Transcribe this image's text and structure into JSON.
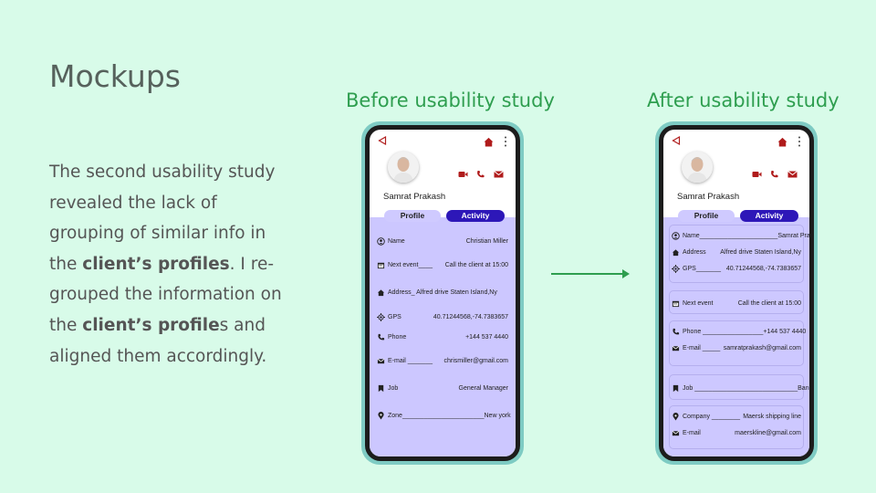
{
  "slide": {
    "title": "Mockups",
    "body": {
      "p1": "The second usability study revealed the lack of grouping of similar info in the ",
      "b1": "client’s profiles",
      "p2": ". I re-grouped the information on the ",
      "b2": "client’s profile",
      "p3": "s and aligned them accordingly."
    }
  },
  "before": {
    "heading": "Before usability study",
    "client_name": "Samrat Prakash",
    "tabs": {
      "profile": "Profile",
      "activity": "Activity"
    },
    "rows": [
      {
        "icon": "person-icon",
        "label": "Name",
        "value": "Christian Miller"
      },
      {
        "icon": "calendar-icon",
        "label": "Next event____",
        "value": "Call the client at 15:00"
      },
      {
        "icon": "home-icon",
        "label": "Address_ Alfred drive Staten Island,Ny",
        "value": ""
      },
      {
        "icon": "gps-icon",
        "label": "GPS",
        "value": "40.71244568,-74.7383657"
      },
      {
        "icon": "phone-icon",
        "label": "Phone",
        "value": "+144 537 4440"
      },
      {
        "icon": "mail-icon",
        "label": "E-mail _______",
        "value": "chrismiller@gmail.com"
      },
      {
        "icon": "bookmark-icon",
        "label": "Job",
        "value": "General Manager"
      },
      {
        "icon": "pin-icon",
        "label": "Zone_______________________",
        "value": "New york"
      }
    ]
  },
  "after": {
    "heading": "After usability study",
    "client_name": "Samrat Prakash",
    "tabs": {
      "profile": "Profile",
      "activity": "Activity"
    },
    "groups": [
      {
        "rows": [
          {
            "icon": "person-icon",
            "label": "Name______________________",
            "value": "Samrat Prakash"
          },
          {
            "icon": "home-icon",
            "label": "Address",
            "value": "Alfred drive Staten Island,Ny"
          },
          {
            "icon": "gps-icon",
            "label": "GPS_______",
            "value": "40.71244568,-74.7383657"
          }
        ]
      },
      {
        "rows": [
          {
            "icon": "calendar-icon",
            "label": "Next event",
            "value": "Call the client at 15:00"
          }
        ]
      },
      {
        "rows": [
          {
            "icon": "phone-icon",
            "label": "Phone _________________",
            "value": "+144 537 4440"
          },
          {
            "icon": "mail-icon",
            "label": "E-mail _____",
            "value": "samratprakash@gmail.com"
          }
        ]
      },
      {
        "rows": [
          {
            "icon": "bookmark-icon",
            "label": "Job _____________________________",
            "value": "Banker"
          }
        ]
      },
      {
        "rows": [
          {
            "icon": "pin-icon",
            "label": "Company ________",
            "value": "Maersk shipping line"
          },
          {
            "icon": "mail-icon",
            "label": "E-mail",
            "value": "maerskline@gmail.com"
          }
        ]
      }
    ]
  },
  "colors": {
    "accent_red": "#b01c1c",
    "accent_green": "#2e9e4f",
    "tab_active": "#2d17b8",
    "panel": "#ccc7ff"
  }
}
